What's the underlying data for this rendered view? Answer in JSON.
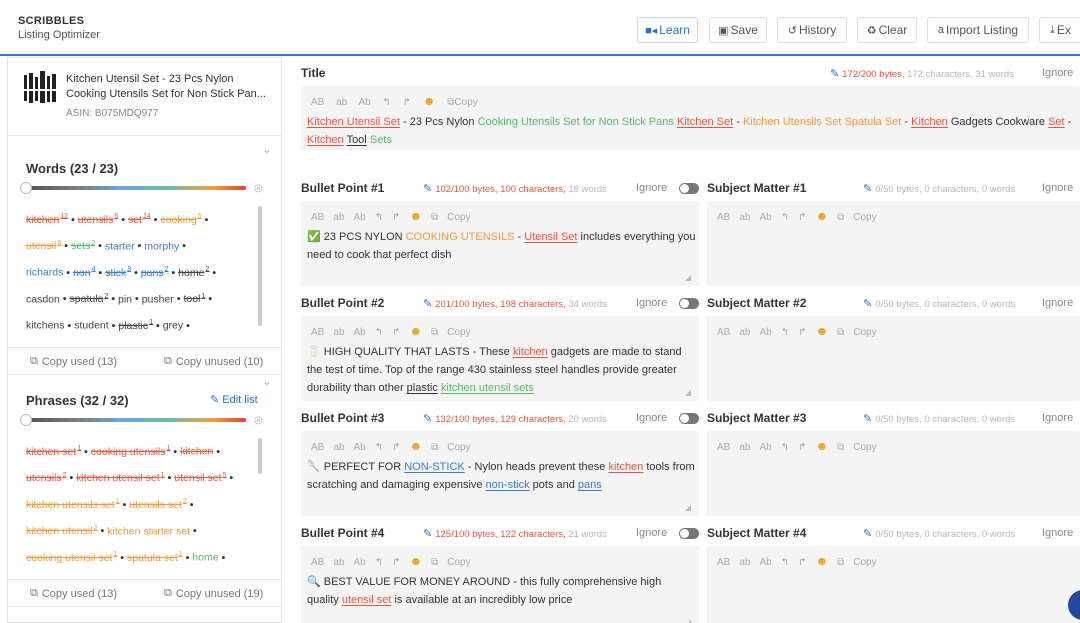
{
  "app": {
    "name": "SCRIBBLES",
    "subtitle": "Listing Optimizer"
  },
  "toolbar": {
    "learn": "Learn",
    "save": "Save",
    "history": "History",
    "clear": "Clear",
    "import": "Import Listing",
    "export": "Ex"
  },
  "product": {
    "title_line1": "Kitchen Utensil Set - 23 Pcs Nylon",
    "title_line2": "Cooking Utensils Set for Non Stick Pan...",
    "asin": "ASIN: B075MDQ977"
  },
  "words": {
    "heading": "Words (23 / 23)",
    "lines": [
      [
        {
          "t": "kitchen",
          "n": "12",
          "c": "red",
          "used": true
        },
        {
          "t": "utensils",
          "n": "6",
          "c": "red",
          "used": true
        },
        {
          "t": "set",
          "n": "14",
          "c": "red",
          "used": true
        },
        {
          "t": "cooking",
          "n": "5",
          "c": "orange",
          "used": true
        }
      ],
      [
        {
          "t": "utensil",
          "n": "6",
          "c": "orange",
          "used": true
        },
        {
          "t": "sets",
          "n": "2",
          "c": "green",
          "used": true
        },
        {
          "t": "starter",
          "n": "",
          "c": "blue",
          "used": false
        },
        {
          "t": "morphy",
          "n": "",
          "c": "blue",
          "used": false
        }
      ],
      [
        {
          "t": "richards",
          "n": "",
          "c": "blue",
          "used": false
        },
        {
          "t": "non",
          "n": "4",
          "c": "blue",
          "used": true
        },
        {
          "t": "stick",
          "n": "3",
          "c": "blue",
          "used": true
        },
        {
          "t": "pans",
          "n": "2",
          "c": "blue",
          "used": true
        },
        {
          "t": "home",
          "n": "2",
          "c": "grey",
          "used": true
        }
      ],
      [
        {
          "t": "casdon",
          "n": "",
          "c": "grey",
          "used": false
        },
        {
          "t": "spatula",
          "n": "2",
          "c": "grey",
          "used": true
        },
        {
          "t": "pin",
          "n": "",
          "c": "grey",
          "used": false
        },
        {
          "t": "pusher",
          "n": "",
          "c": "grey",
          "used": false
        },
        {
          "t": "tool",
          "n": "1",
          "c": "grey",
          "used": true
        }
      ],
      [
        {
          "t": "kitchens",
          "n": "",
          "c": "grey",
          "used": false
        },
        {
          "t": "student",
          "n": "",
          "c": "grey",
          "used": false
        },
        {
          "t": "plastic",
          "n": "1",
          "c": "grey",
          "used": true
        },
        {
          "t": "grey",
          "n": "",
          "c": "grey",
          "used": false
        }
      ]
    ],
    "copy_used": "Copy used (13)",
    "copy_unused": "Copy unused (10)"
  },
  "phrases": {
    "heading": "Phrases (32 / 32)",
    "edit_list": "Edit list",
    "lines": [
      [
        {
          "t": "kitchen set",
          "n": "1",
          "c": "red",
          "used": true
        },
        {
          "t": "cooking utensils",
          "n": "1",
          "c": "red",
          "used": true
        },
        {
          "t": "kitchen",
          "n": "",
          "c": "red",
          "used": true
        }
      ],
      [
        {
          "t": "utensils",
          "n": "2",
          "c": "red",
          "used": true
        },
        {
          "t": "kitchen utensil set",
          "n": "1",
          "c": "red",
          "used": true
        },
        {
          "t": "utensil set",
          "n": "5",
          "c": "red",
          "used": true
        }
      ],
      [
        {
          "t": "kitchen utensils set",
          "n": "1",
          "c": "orange",
          "used": true
        },
        {
          "t": "utensils set",
          "n": "2",
          "c": "orange",
          "used": true
        }
      ],
      [
        {
          "t": "kitchen utensil",
          "n": "2",
          "c": "orange",
          "used": true
        },
        {
          "t": "kitchen starter set",
          "n": "",
          "c": "orange",
          "used": false
        }
      ],
      [
        {
          "t": "cooking utensil set",
          "n": "1",
          "c": "orange",
          "used": true
        },
        {
          "t": "spatula set",
          "n": "1",
          "c": "orange",
          "used": true
        },
        {
          "t": "home",
          "n": "",
          "c": "green",
          "used": false
        }
      ]
    ],
    "copy_used": "Copy used (13)",
    "copy_unused": "Copy unused (19)"
  },
  "formatting": {
    "upper": "AB",
    "lower": "ab",
    "title": "Ab",
    "copy": "Copy"
  },
  "ignore_label": "Ignore",
  "title_field": {
    "label": "Title",
    "bytes": "172/200 bytes,",
    "rest": "172 characters, 31 words",
    "segments": [
      {
        "t": "Kitchen Utensil Set",
        "c": "red",
        "u": true
      },
      {
        "t": " - 23 Pcs Nylon ",
        "c": "",
        "u": false
      },
      {
        "t": "Cooking Utensils Set for Non Stick Pans",
        "c": "green",
        "u": false
      },
      {
        "t": " ",
        "c": "",
        "u": false
      },
      {
        "t": "Kitchen Set",
        "c": "red",
        "u": true
      },
      {
        "t": " - ",
        "c": "",
        "u": false
      },
      {
        "t": "Kitchen Utensils Set",
        "c": "orange",
        "u": false
      },
      {
        "t": " ",
        "c": "",
        "u": false
      },
      {
        "t": "Spatula Set",
        "c": "orange",
        "u": false
      },
      {
        "t": " - ",
        "c": "",
        "u": false
      },
      {
        "t": "Kitchen",
        "c": "red",
        "u": true
      },
      {
        "t": " Gadgets Cookware ",
        "c": "",
        "u": false
      },
      {
        "t": "Set",
        "c": "red",
        "u": true
      },
      {
        "t": " -",
        "c": "",
        "u": false
      }
    ],
    "segments2": [
      {
        "t": "Kitchen",
        "c": "red",
        "u": true
      },
      {
        "t": " ",
        "c": "",
        "u": false
      },
      {
        "t": "Tool",
        "c": "",
        "u": true
      },
      {
        "t": " ",
        "c": "",
        "u": false
      },
      {
        "t": "Sets",
        "c": "green",
        "u": false
      }
    ]
  },
  "bullets": [
    {
      "label": "Bullet Point #1",
      "bytes": "102/100 bytes,",
      "chars": "100 characters,",
      "rest": "18 words",
      "lines": [
        [
          {
            "t": "✅ ",
            "c": "",
            "u": false
          },
          {
            "t": "23 PCS NYLON ",
            "c": "",
            "u": false
          },
          {
            "t": "COOKING UTENSILS",
            "c": "orange",
            "u": false
          },
          {
            "t": " - ",
            "c": "",
            "u": false
          },
          {
            "t": "Utensil Set",
            "c": "red",
            "u": true
          },
          {
            "t": " includes everything you",
            "c": "",
            "u": false
          }
        ],
        [
          {
            "t": "need to cook that perfect dish",
            "c": "",
            "u": false
          }
        ]
      ]
    },
    {
      "label": "Bullet Point #2",
      "bytes": "201/100 bytes,",
      "chars": "198 characters,",
      "rest": "34 words",
      "lines": [
        [
          {
            "t": "🥛 HIGH QUALITY THAT LASTS - These ",
            "c": "",
            "u": false
          },
          {
            "t": "kitchen",
            "c": "red",
            "u": true
          },
          {
            "t": " gadgets are made to stand",
            "c": "",
            "u": false
          }
        ],
        [
          {
            "t": "the test of time. Top of the range 430 stainless steel handles provide greater",
            "c": "",
            "u": false
          }
        ],
        [
          {
            "t": "durability than other ",
            "c": "",
            "u": false
          },
          {
            "t": "plastic",
            "c": "",
            "u": true
          },
          {
            "t": " ",
            "c": "",
            "u": false
          },
          {
            "t": "kitchen utensil sets",
            "c": "green",
            "u": true
          }
        ]
      ]
    },
    {
      "label": "Bullet Point #3",
      "bytes": "132/100 bytes,",
      "chars": "129 characters,",
      "rest": "20 words",
      "lines": [
        [
          {
            "t": "🥄 PERFECT FOR ",
            "c": "",
            "u": false
          },
          {
            "t": "NON-STICK",
            "c": "blue",
            "u": true
          },
          {
            "t": " - Nylon heads prevent these ",
            "c": "",
            "u": false
          },
          {
            "t": "kitchen",
            "c": "red",
            "u": true
          },
          {
            "t": " tools from",
            "c": "",
            "u": false
          }
        ],
        [
          {
            "t": "scratching and damaging expensive ",
            "c": "",
            "u": false
          },
          {
            "t": "non-stick",
            "c": "blue",
            "u": true
          },
          {
            "t": " pots and ",
            "c": "",
            "u": false
          },
          {
            "t": "pans",
            "c": "blue",
            "u": true
          }
        ]
      ]
    },
    {
      "label": "Bullet Point #4",
      "bytes": "125/100 bytes,",
      "chars": "122 characters,",
      "rest": "21 words",
      "lines": [
        [
          {
            "t": "🔍 BEST VALUE FOR MONEY AROUND - this fully comprehensive high",
            "c": "",
            "u": false
          }
        ],
        [
          {
            "t": "quality ",
            "c": "",
            "u": false
          },
          {
            "t": "utensil set",
            "c": "red",
            "u": true
          },
          {
            "t": " is available at an incredibly low price",
            "c": "",
            "u": false
          }
        ]
      ]
    }
  ],
  "subjects": [
    {
      "label": "Subject Matter #1",
      "stats": "0/50 bytes, 0 characters, 0 words"
    },
    {
      "label": "Subject Matter #2",
      "stats": "0/50 bytes, 0 characters, 0 words"
    },
    {
      "label": "Subject Matter #3",
      "stats": "0/50 bytes, 0 characters, 0 words"
    },
    {
      "label": "Subject Matter #4",
      "stats": "0/50 bytes, 0 characters, 0 words"
    }
  ],
  "colors": {
    "red": "#e8563f",
    "orange": "#f19a3e",
    "green": "#55b86a",
    "blue": "#3a7bd5",
    "accent": "#2b6fd6"
  }
}
